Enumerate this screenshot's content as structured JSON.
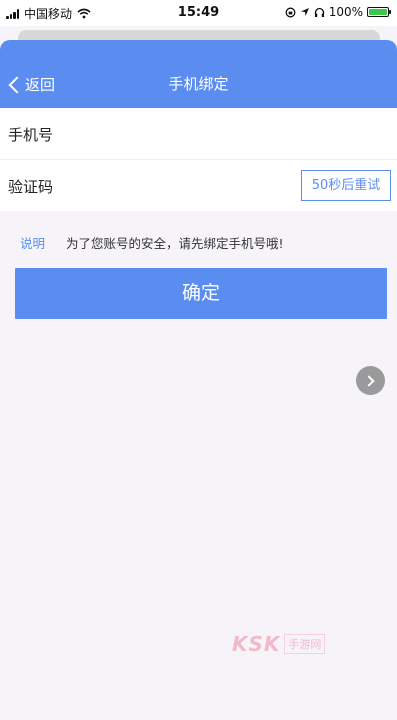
{
  "status_bar": {
    "carrier": "中国移动",
    "time": "15:49",
    "battery": "100%",
    "battery_level": 1.0,
    "icons": [
      "signal-icon",
      "wifi-icon",
      "orientation-lock-icon",
      "location-icon",
      "headphones-icon",
      "battery-icon"
    ]
  },
  "nav": {
    "back_label": "返回",
    "title": "手机绑定"
  },
  "form": {
    "phone_label": "手机号",
    "phone_value": "",
    "code_label": "验证码",
    "code_value": "",
    "resend_label": "50秒后重试"
  },
  "note": {
    "label": "说明",
    "text": "为了您账号的安全，请先绑定手机号哦!"
  },
  "confirm_label": "确定",
  "watermark": {
    "logo": "KSK",
    "sub": "手游网"
  },
  "colors": {
    "accent": "#5b8df0",
    "background": "#f6f4f8"
  }
}
